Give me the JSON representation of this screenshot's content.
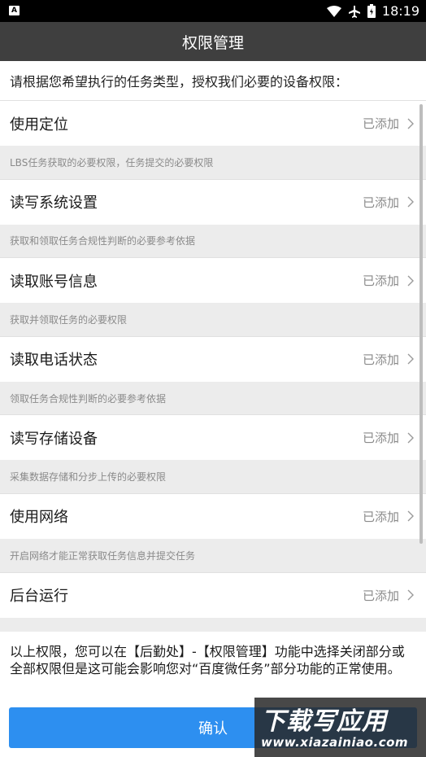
{
  "status_bar": {
    "sim_label": "A",
    "time": "18:19"
  },
  "header": {
    "title": "权限管理"
  },
  "intro": "请根据您希望执行的任务类型，授权我们必要的设备权限：",
  "permissions": [
    {
      "name": "使用定位",
      "status": "已添加",
      "desc": "LBS任务获取的必要权限，任务提交的必要权限"
    },
    {
      "name": "读写系统设置",
      "status": "已添加",
      "desc": "获取和领取任务合规性判断的必要参考依据"
    },
    {
      "name": "读取账号信息",
      "status": "已添加",
      "desc": "获取并领取任务的必要权限"
    },
    {
      "name": "读取电话状态",
      "status": "已添加",
      "desc": "领取任务合规性判断的必要参考依据"
    },
    {
      "name": "读写存储设备",
      "status": "已添加",
      "desc": "采集数据存储和分步上传的必要权限"
    },
    {
      "name": "使用网络",
      "status": "已添加",
      "desc": "开启网络才能正常获取任务信息并提交任务"
    },
    {
      "name": "后台运行",
      "status": "已添加",
      "desc": ""
    }
  ],
  "footer": {
    "note": "以上权限，您可以在【后勤处】-【权限管理】功能中选择关闭部分或全部权限但是这可能会影响您对“百度微任务”部分功能的正常使用。",
    "confirm_label": "确认"
  },
  "watermark": {
    "title": "下载写应用",
    "url": "www.xiazainiao.com"
  },
  "colors": {
    "title_bar": "#3f3f3f",
    "accent": "#2d8ff0",
    "desc_bg": "#ececec"
  }
}
